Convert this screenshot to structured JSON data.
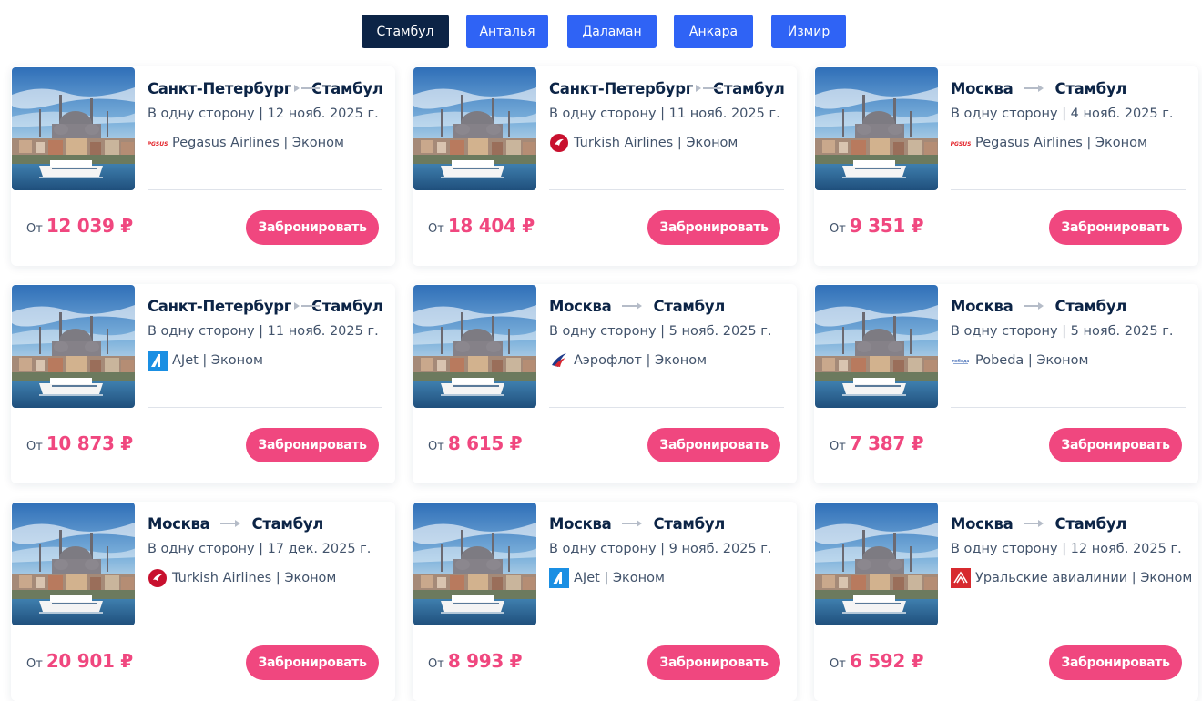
{
  "tabs": [
    {
      "label": "Стамбул",
      "active": true
    },
    {
      "label": "Анталья",
      "active": false
    },
    {
      "label": "Даламан",
      "active": false
    },
    {
      "label": "Анкара",
      "active": false
    },
    {
      "label": "Измир",
      "active": false
    }
  ],
  "cards": [
    {
      "from": "Санкт-Петербург",
      "to": "Стамбул",
      "details": "В одну сторону | 12 нояб. 2025 г.",
      "airline": "Pegasus Airlines | Эконом",
      "logo": "pegasus-logo-icon",
      "price_prefix": "От",
      "price": "12 039 ₽",
      "button": "Забронировать"
    },
    {
      "from": "Санкт-Петербург",
      "to": "Стамбул",
      "details": "В одну сторону | 11 нояб. 2025 г.",
      "airline": "Turkish Airlines | Эконом",
      "logo": "turkish-airlines-logo-icon",
      "price_prefix": "От",
      "price": "18 404 ₽",
      "button": "Забронировать"
    },
    {
      "from": "Москва",
      "to": "Стамбул",
      "details": "В одну сторону | 4 нояб. 2025 г.",
      "airline": "Pegasus Airlines | Эконом",
      "logo": "pegasus-logo-icon",
      "price_prefix": "От",
      "price": "9 351 ₽",
      "button": "Забронировать"
    },
    {
      "from": "Санкт-Петербург",
      "to": "Стамбул",
      "details": "В одну сторону | 11 нояб. 2025 г.",
      "airline": "AJet | Эконом",
      "logo": "ajet-logo-icon",
      "price_prefix": "От",
      "price": "10 873 ₽",
      "button": "Забронировать"
    },
    {
      "from": "Москва",
      "to": "Стамбул",
      "details": "В одну сторону | 5 нояб. 2025 г.",
      "airline": "Аэрофлот | Эконом",
      "logo": "aeroflot-logo-icon",
      "price_prefix": "От",
      "price": "8 615 ₽",
      "button": "Забронировать"
    },
    {
      "from": "Москва",
      "to": "Стамбул",
      "details": "В одну сторону | 5 нояб. 2025 г.",
      "airline": "Pobeda | Эконом",
      "logo": "pobeda-logo-icon",
      "price_prefix": "От",
      "price": "7 387 ₽",
      "button": "Забронировать"
    },
    {
      "from": "Москва",
      "to": "Стамбул",
      "details": "В одну сторону | 17 дек. 2025 г.",
      "airline": "Turkish Airlines | Эконом",
      "logo": "turkish-airlines-logo-icon",
      "price_prefix": "От",
      "price": "20 901 ₽",
      "button": "Забронировать"
    },
    {
      "from": "Москва",
      "to": "Стамбул",
      "details": "В одну сторону | 9 нояб. 2025 г.",
      "airline": "AJet | Эконом",
      "logo": "ajet-logo-icon",
      "price_prefix": "От",
      "price": "8 993 ₽",
      "button": "Забронировать"
    },
    {
      "from": "Москва",
      "to": "Стамбул",
      "details": "В одну сторону | 12 нояб. 2025 г.",
      "airline": "Уральские авиалинии | Эконом",
      "logo": "ural-airlines-logo-icon",
      "price_prefix": "От",
      "price": "6 592 ₽",
      "button": "Забронировать"
    }
  ],
  "colors": {
    "accent": "#f0477f",
    "tab": "#2f63f5",
    "tab_active": "#0c2446",
    "title": "#0c2446"
  }
}
